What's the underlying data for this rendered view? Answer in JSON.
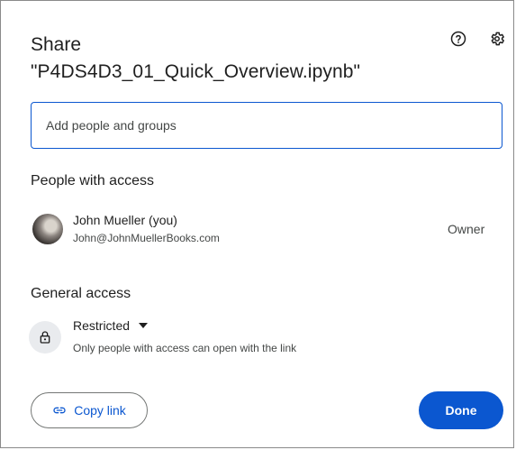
{
  "dialog": {
    "title": "Share",
    "file_name": "\"P4DS4D3_01_Quick_Overview.ipynb\"",
    "help_icon": "help-circle-icon",
    "settings_icon": "gear-icon"
  },
  "search": {
    "placeholder": "Add people and groups",
    "value": ""
  },
  "people_section": {
    "heading": "People with access",
    "people": [
      {
        "name": "John Mueller (you)",
        "email": "John@JohnMuellerBooks.com",
        "role": "Owner"
      }
    ]
  },
  "general_access": {
    "heading": "General access",
    "icon": "lock-icon",
    "level": "Restricted",
    "description": "Only people with access can open with the link"
  },
  "actions": {
    "copy_link": "Copy link",
    "copy_icon": "link-icon",
    "done": "Done"
  },
  "colors": {
    "accent": "#0b57d0",
    "text": "#1f1f1f",
    "muted": "#444746"
  }
}
